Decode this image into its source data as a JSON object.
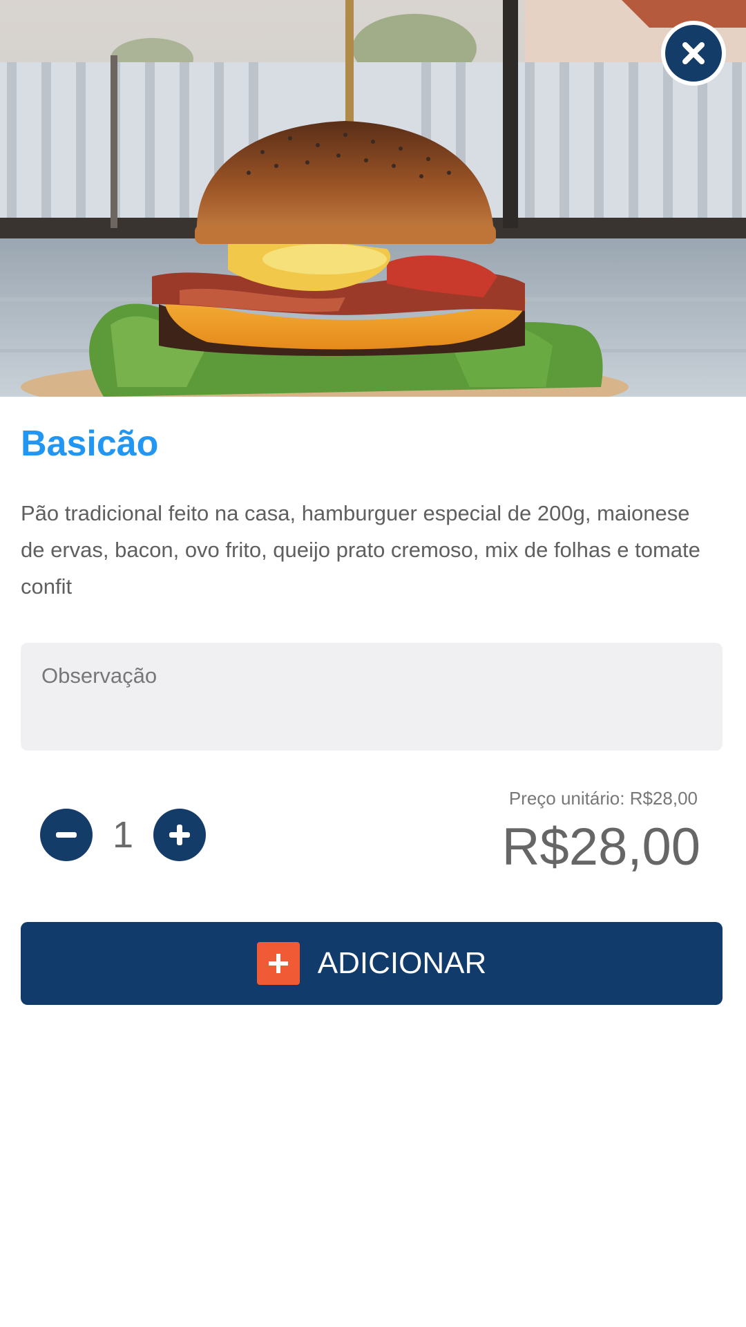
{
  "product": {
    "image_alt": "burger photo",
    "name": "Basicão",
    "description": "Pão tradicional feito na casa, hamburguer especial de 200g, maionese de ervas, bacon, ovo frito, queijo prato cremoso, mix de folhas e tomate confit"
  },
  "observation": {
    "placeholder": "Observação",
    "value": ""
  },
  "quantity": {
    "value": "1",
    "decrease_icon": "minus-icon",
    "increase_icon": "plus-icon"
  },
  "price": {
    "unit_label": "Preço unitário: R$28,00",
    "total": "R$28,00"
  },
  "add_button": {
    "label": "ADICIONAR",
    "icon": "plus-square-icon"
  },
  "close_icon": "close-icon",
  "colors": {
    "title": "#2196f3",
    "primary": "#113b6b",
    "accent": "#f05a35",
    "input_bg": "#f0f0f2"
  }
}
